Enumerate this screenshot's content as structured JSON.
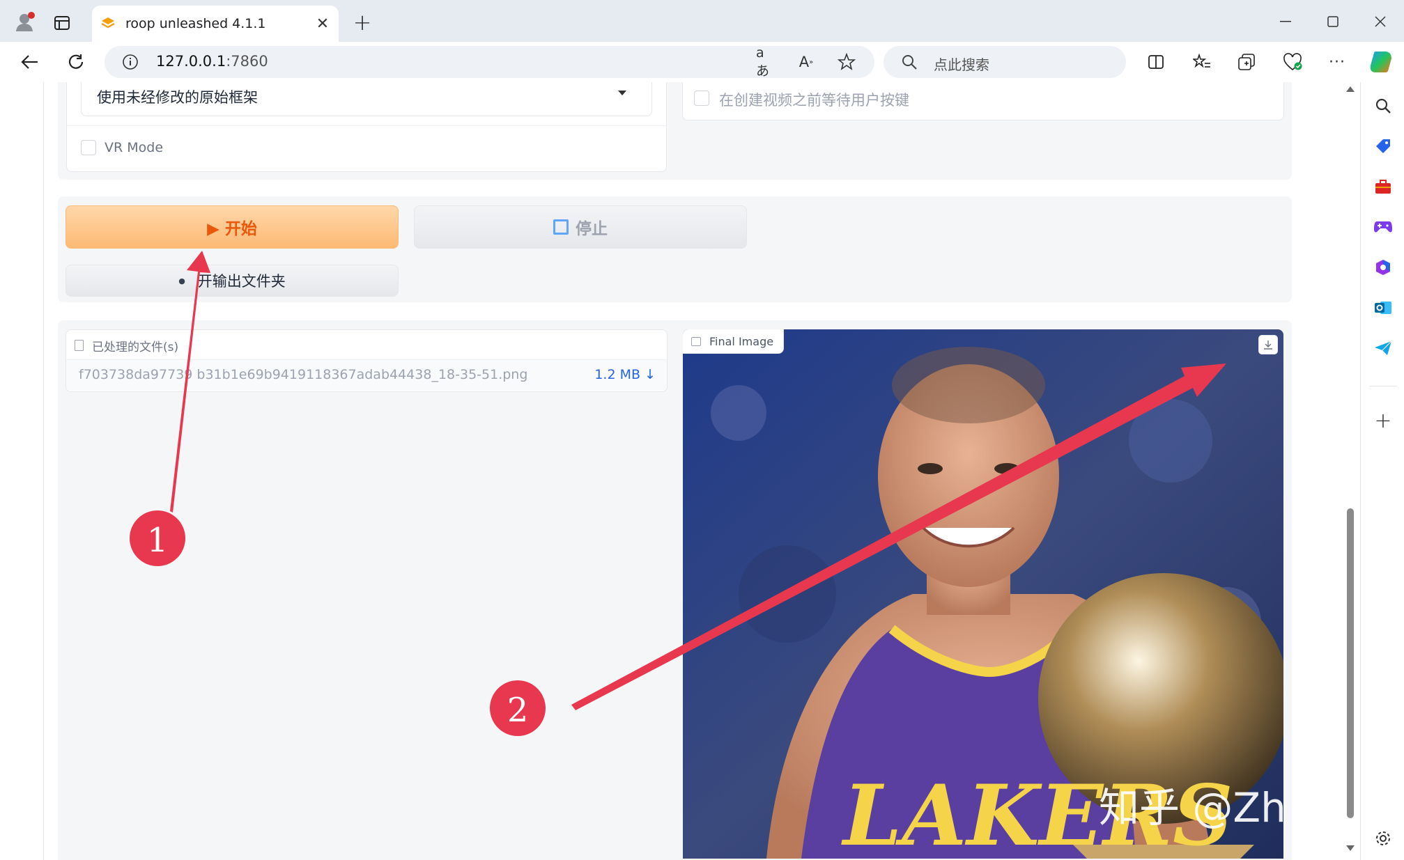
{
  "browser": {
    "tab_title": "roop unleashed 4.1.1",
    "url_host": "127.0.0.1",
    "url_port": ":7860",
    "search_placeholder": "点此搜索",
    "window_controls": [
      "minimize-icon",
      "maximize-icon",
      "close-icon"
    ],
    "sidebar_icons": [
      "search-icon",
      "tag-icon",
      "briefcase-icon",
      "games-icon",
      "office-icon",
      "outlook-icon",
      "telegram-icon",
      "add-icon",
      "settings-icon"
    ]
  },
  "settings": {
    "frame_processing_select": "使用未经修改的原始框架",
    "vr_mode_label": "VR Mode",
    "wait_user_label": "在创建视频之前等待用户按键"
  },
  "actions": {
    "start_label": "▶ 开始",
    "stop_label": "停止",
    "open_folder_label": "开输出文件夹"
  },
  "files": {
    "label": "已处理的文件(s)",
    "filename": "f703738da97739 b31b1e69b9419118367adab44438_18-35-51.png",
    "size": "1.2 MB ↓"
  },
  "image": {
    "label": "Final Image",
    "jersey_text": "LAKERS",
    "watermark": "知乎 @Zhikes"
  },
  "annotations": {
    "marker1": "1",
    "marker2": "2"
  },
  "colors": {
    "start_gradient_top": "#fed7aa",
    "start_gradient_bottom": "#fdba74",
    "start_text": "#ea580c",
    "marker_red": "#e8384f",
    "link_blue": "#2563eb"
  }
}
